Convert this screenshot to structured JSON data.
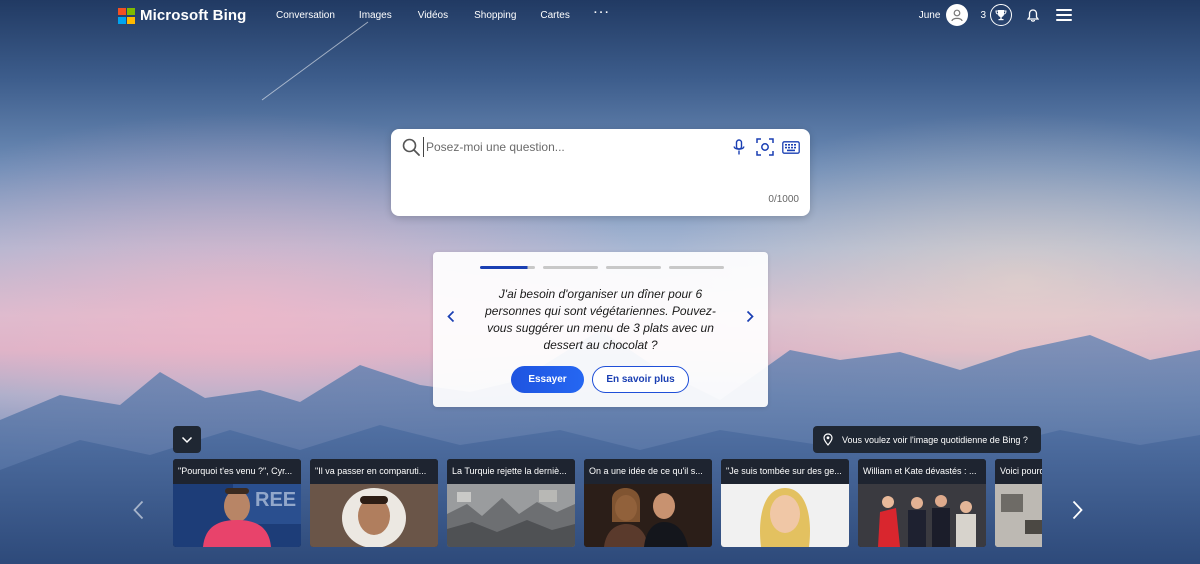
{
  "brand": {
    "name": "Microsoft Bing",
    "logo_colors": [
      "#f25022",
      "#7fba00",
      "#00a4ef",
      "#ffb900"
    ]
  },
  "nav": {
    "items": [
      {
        "label": "Conversation"
      },
      {
        "label": "Images"
      },
      {
        "label": "Vidéos"
      },
      {
        "label": "Shopping"
      },
      {
        "label": "Cartes"
      }
    ],
    "more_label": "···"
  },
  "user": {
    "name": "June",
    "points": "3",
    "avatar_icon": "person-icon",
    "trophy_icon": "trophy-icon",
    "bell_icon": "bell-icon",
    "menu_icon": "hamburger-menu-icon"
  },
  "search": {
    "placeholder": "Posez-moi une question...",
    "value": "",
    "counter": "0/1000",
    "icons": [
      "search-icon",
      "microphone-icon",
      "visual-search-icon",
      "keyboard-icon"
    ]
  },
  "suggestion": {
    "text": "J'ai besoin d'organiser un dîner pour 6 personnes qui sont végétariennes. Pouvez-vous suggérer un menu de 3 plats avec un dessert au chocolat ?",
    "try_label": "Essayer",
    "learn_label": "En savoir plus",
    "slide_count": 4,
    "active_slide": 1
  },
  "daily_image": {
    "label": "Vous voulez voir l'image quotidienne de Bing ?",
    "icon": "location-pin-icon"
  },
  "news": [
    {
      "title": "\"Pourquoi t'es venu ?\", Cyr..."
    },
    {
      "title": "\"Il va passer en comparuti..."
    },
    {
      "title": "La Turquie rejette la derniè..."
    },
    {
      "title": "On a une idée de ce qu'il s..."
    },
    {
      "title": "\"Je suis tombée sur des ge..."
    },
    {
      "title": "William et Kate dévastés : ..."
    },
    {
      "title": "Voici pourq"
    }
  ],
  "colors": {
    "accent": "#1f54e0",
    "dark_button": "#1f2733"
  }
}
